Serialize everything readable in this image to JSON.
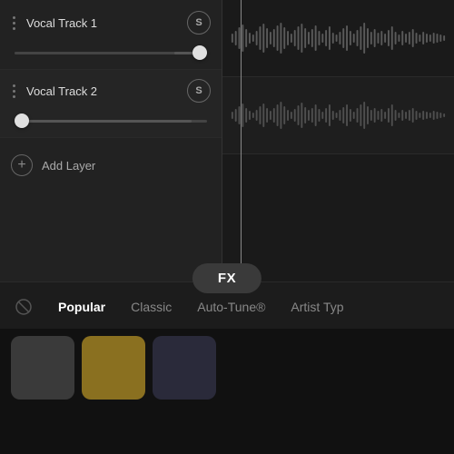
{
  "tracks": [
    {
      "id": "track1",
      "name": "Vocal Track 1",
      "s_label": "S",
      "slider_value": 85,
      "thumb_position_pct": 83
    },
    {
      "id": "track2",
      "name": "Vocal Track 2",
      "s_label": "S",
      "slider_value": 15,
      "thumb_position_pct": 8
    }
  ],
  "add_layer": {
    "label": "Add Layer",
    "icon": "+"
  },
  "fx_button": {
    "label": "FX"
  },
  "tabs": [
    {
      "id": "disabled",
      "label": "⊘",
      "active": false
    },
    {
      "id": "popular",
      "label": "Popular",
      "active": true
    },
    {
      "id": "classic",
      "label": "Classic",
      "active": false
    },
    {
      "id": "autotune",
      "label": "Auto-Tune®",
      "active": false
    },
    {
      "id": "artisttyp",
      "label": "Artist Typ",
      "active": false
    }
  ],
  "dots_menu": "⋮",
  "colors": {
    "accent": "#ffffff",
    "background": "#1a1a1a",
    "track_bg": "#222222",
    "waveform": "#666666"
  }
}
